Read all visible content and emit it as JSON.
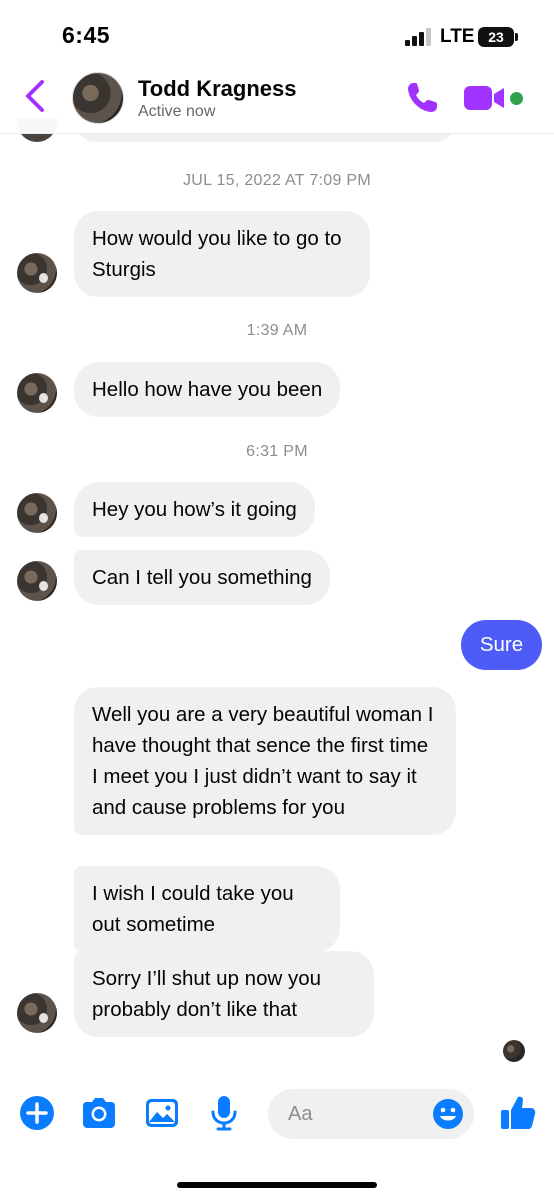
{
  "status_bar": {
    "time": "6:45",
    "network": "LTE",
    "battery": "23"
  },
  "header": {
    "back_icon": "chevron-left-icon",
    "contact_name": "Todd Kragness",
    "contact_status": "Active now",
    "call_icon": "phone-icon",
    "video_icon": "video-camera-icon",
    "accent_color": "#a033ff"
  },
  "conversation": {
    "timestamps": [
      "JUL 15, 2022 AT 7:09 PM",
      "1:39 AM",
      "6:31 PM"
    ],
    "received": [
      "How would you like to go to Sturgis",
      "Hello how have you been",
      "Hey you how’s it going",
      "Can I tell you something",
      "Well you are a very beautiful woman I have thought that sence the first time I meet you I just didn’t want to say it and cause problems for you",
      "I wish I could take you out sometime",
      "Sorry I’ll shut up now you probably don’t like that"
    ],
    "sent": [
      "Sure"
    ],
    "received_bubble_color": "#f0f0f0",
    "sent_bubble_color": "#4d5cf6"
  },
  "composer": {
    "placeholder": "Aa",
    "icons": [
      "plus-circle-icon",
      "camera-icon",
      "photo-icon",
      "microphone-icon",
      "emoji-icon",
      "thumbs-up-icon"
    ],
    "accent_color": "#0a7cff"
  }
}
